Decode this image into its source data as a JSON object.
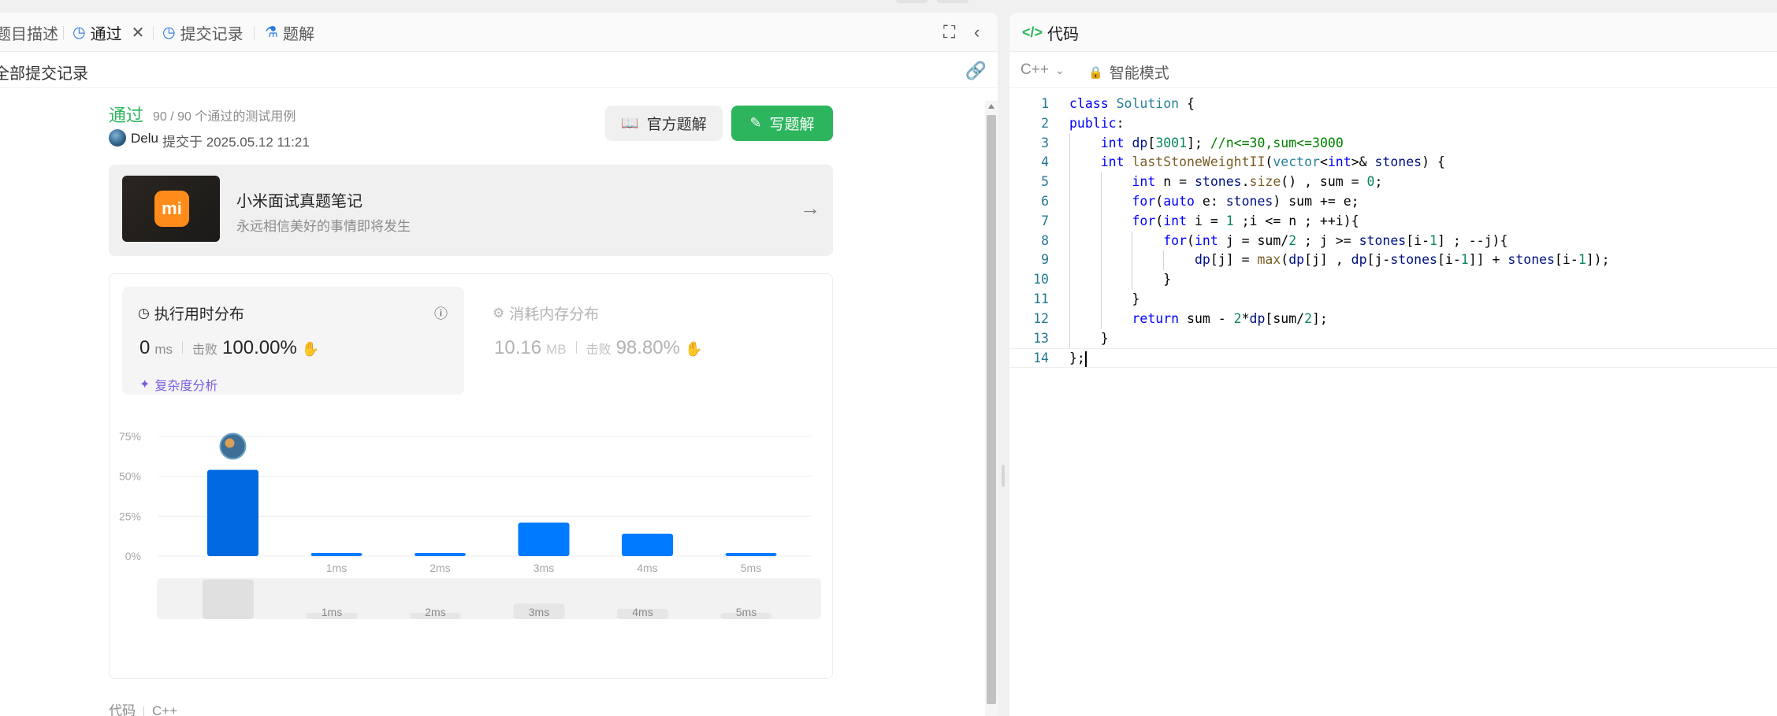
{
  "left_tabs": [
    {
      "label": "题目描述",
      "icon": "description-icon"
    },
    {
      "label": "通过",
      "icon": "history-icon",
      "closable": true
    },
    {
      "label": "提交记录",
      "icon": "history-icon"
    },
    {
      "label": "题解",
      "icon": "flask-icon"
    }
  ],
  "breadcrumb": "全部提交记录",
  "submission": {
    "status": "通过",
    "cases": "90 / 90 个通过的测试用例",
    "submitter": "Delu",
    "submitted_at": "提交于 2025.05.12 11:21",
    "official_btn": "官方题解",
    "write_btn": "写题解"
  },
  "promo": {
    "title": "小米面试真题笔记",
    "desc": "永远相信美好的事情即将发生",
    "logo": "mi"
  },
  "runtime": {
    "title": "执行用时分布",
    "value": "0",
    "unit": "ms",
    "beat_label": "击败",
    "beat_pct": "100.00%",
    "analysis": "复杂度分析"
  },
  "memory": {
    "title": "消耗内存分布",
    "value": "10.16",
    "unit": "MB",
    "beat_label": "击败",
    "beat_pct": "98.80%"
  },
  "chart_data": {
    "type": "bar",
    "categories": [
      "",
      "1ms",
      "2ms",
      "3ms",
      "4ms",
      "5ms"
    ],
    "values": [
      54,
      2,
      2,
      21,
      14,
      2
    ],
    "yticks": [
      "75%",
      "50%",
      "25%",
      "0%"
    ],
    "ylim": [
      0,
      75
    ],
    "highlight_index": 0,
    "colors": {
      "highlight": "#0069e0",
      "bar": "#007aff",
      "grid": "#ececec",
      "overview": "#e6e6e6"
    }
  },
  "bottom": {
    "label": "代码",
    "lang": "C++"
  },
  "editor": {
    "tab": "代码",
    "lang": "C++",
    "mode": "智能模式",
    "lines": [
      "class Solution {",
      "public:",
      "    int dp[3001]; //n<=30,sum<=3000",
      "    int lastStoneWeightII(vector<int>& stones) {",
      "        int n = stones.size() , sum = 0;",
      "        for(auto e: stones) sum += e;",
      "        for(int i = 1 ;i <= n ; ++i){",
      "            for(int j = sum/2 ; j >= stones[i-1] ; --j){",
      "                dp[j] = max(dp[j] , dp[j-stones[i-1]] + stones[i-1]);",
      "            }",
      "        }",
      "        return sum - 2*dp[sum/2];",
      "    }",
      "};"
    ]
  }
}
